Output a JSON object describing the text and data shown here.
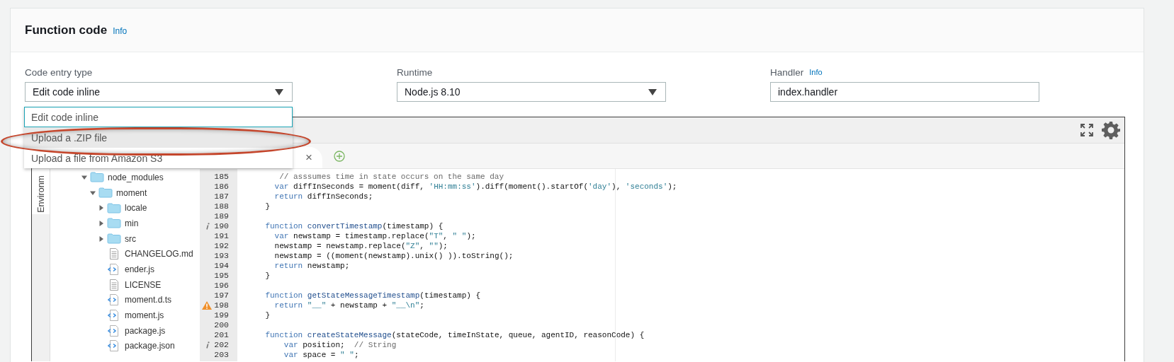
{
  "panel": {
    "title": "Function code",
    "info_link": "Info"
  },
  "fields": [
    {
      "kind": "select",
      "label": "Code entry type",
      "value": "Edit code inline"
    },
    {
      "kind": "select",
      "label": "Runtime",
      "value": "Node.js 8.10"
    },
    {
      "kind": "text",
      "label": "Handler",
      "info_link": "Info",
      "value": "index.handler"
    }
  ],
  "dropdown": {
    "options": [
      {
        "label": "Edit code inline",
        "selected": true,
        "hovered": false
      },
      {
        "label": "Upload a .ZIP file",
        "selected": false,
        "hovered": true
      },
      {
        "label": "Upload a file from Amazon S3",
        "selected": false,
        "hovered": false
      }
    ]
  },
  "editor": {
    "side_tab": "Environm",
    "file_tab": {
      "close": "×"
    },
    "tree": [
      {
        "name": "node_modules",
        "kind": "folder",
        "expanded": true,
        "children": [
          {
            "name": "moment",
            "kind": "folder",
            "expanded": true,
            "children": [
              {
                "name": "locale",
                "kind": "folder",
                "expanded": false
              },
              {
                "name": "min",
                "kind": "folder",
                "expanded": false
              },
              {
                "name": "src",
                "kind": "folder",
                "expanded": false
              },
              {
                "name": "CHANGELOG.md",
                "kind": "text"
              },
              {
                "name": "ender.js",
                "kind": "code"
              },
              {
                "name": "LICENSE",
                "kind": "text"
              },
              {
                "name": "moment.d.ts",
                "kind": "code"
              },
              {
                "name": "moment.js",
                "kind": "code"
              },
              {
                "name": "package.js",
                "kind": "code"
              },
              {
                "name": "package.json",
                "kind": "code"
              }
            ]
          }
        ]
      }
    ],
    "code": [
      {
        "number": "185",
        "text": "       // asssumes time in state occurs on the same day"
      },
      {
        "number": "186",
        "text": "      var diffInSeconds = moment(diff, 'HH:mm:ss').diff(moment().startOf('day'), 'seconds');"
      },
      {
        "number": "187",
        "text": "      return diffInSeconds;"
      },
      {
        "number": "188",
        "text": "    }"
      },
      {
        "number": "189"
      },
      {
        "number": "190",
        "text": "    function convertTimestamp(timestamp) {",
        "kind": "info"
      },
      {
        "number": "191",
        "text": "      var newstamp = timestamp.replace(\"T\", \" \");"
      },
      {
        "number": "192",
        "text": "      newstamp = newstamp.replace(\"Z\", \"\");"
      },
      {
        "number": "193",
        "text": "      newstamp = ((moment(newstamp).unix() )).toString();"
      },
      {
        "number": "194",
        "text": "      return newstamp;"
      },
      {
        "number": "195",
        "text": "    }"
      },
      {
        "number": "196"
      },
      {
        "number": "197",
        "text": "    function getStateMessageTimestamp(timestamp) {"
      },
      {
        "number": "198",
        "text": "      return \"__\" + newstamp + \"__\\n\";",
        "kind": "warning"
      },
      {
        "number": "199",
        "text": "    }"
      },
      {
        "number": "200"
      },
      {
        "number": "201",
        "text": "    function createStateMessage(stateCode, timeInState, queue, agentID, reasonCode) {"
      },
      {
        "number": "202",
        "text": "        var position;  // String",
        "kind": "info"
      },
      {
        "number": "203",
        "text": "        var space = \" \";"
      }
    ]
  }
}
